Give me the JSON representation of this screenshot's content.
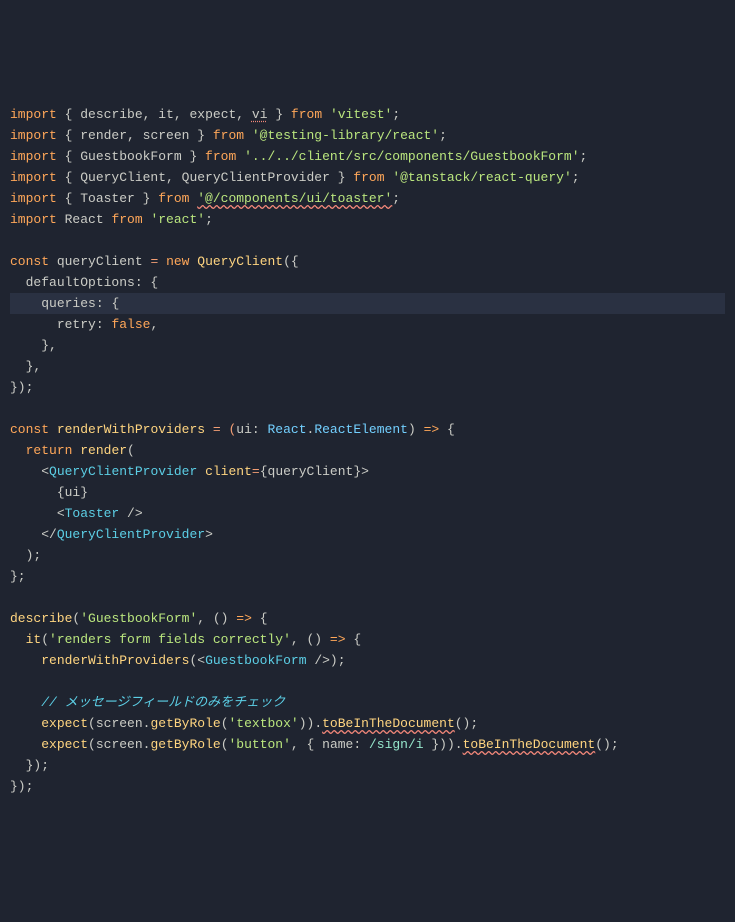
{
  "lines": {
    "l1": {
      "import": "import",
      "lb": "{ ",
      "i1": "describe",
      "c1": ", ",
      "i2": "it",
      "c2": ", ",
      "i3": "expect",
      "c3": ", ",
      "i4": "vi",
      "rb": " }",
      "from": " from ",
      "str": "'vitest'",
      "end": ";"
    },
    "l2": {
      "import": "import",
      "lb": " { ",
      "i1": "render",
      "c1": ", ",
      "i2": "screen",
      "rb": " }",
      "from": " from ",
      "str": "'@testing-library/react'",
      "end": ";"
    },
    "l3": {
      "import": "import",
      "lb": " { ",
      "i1": "GuestbookForm",
      "rb": " }",
      "from": " from ",
      "str": "'../../client/src/components/GuestbookForm'",
      "end": ";"
    },
    "l4": {
      "import": "import",
      "lb": " { ",
      "i1": "QueryClient",
      "c1": ", ",
      "i2": "QueryClientProvider",
      "rb": " }",
      "from": " from ",
      "str": "'@tanstack/react-query'",
      "end": ";"
    },
    "l5": {
      "import": "import",
      "lb": " { ",
      "i1": "Toaster",
      "rb": " }",
      "from": " from ",
      "str": "'@/components/ui/toaster'",
      "end": ";"
    },
    "l6": {
      "import": "import",
      "sp": " ",
      "i1": "React",
      "from": " from ",
      "str": "'react'",
      "end": ";"
    },
    "l8": {
      "const": "const",
      "sp": " ",
      "name": "queryClient",
      "eq": " = ",
      "new": "new",
      "sp2": " ",
      "cls": "QueryClient",
      "paren": "({"
    },
    "l9": {
      "indent": "  ",
      "prop": "defaultOptions",
      "colon": ": {"
    },
    "l10": {
      "indent": "    ",
      "prop": "queries",
      "colon": ": ",
      "brace": "{"
    },
    "l11": {
      "indent": "      ",
      "prop": "retry",
      "colon": ": ",
      "val": "false",
      "end": ","
    },
    "l12": {
      "indent": "    ",
      "brace": "},"
    },
    "l13": {
      "indent": "  ",
      "brace": "},"
    },
    "l14": {
      "brace": "});"
    },
    "l16": {
      "const": "const",
      "sp": " ",
      "name": "renderWithProviders",
      "eq": " = (",
      "param": "ui",
      "colon": ": ",
      "type1": "React",
      "dot": ".",
      "type2": "ReactElement",
      "rparen": ")",
      "arrow": " => ",
      "brace": "{"
    },
    "l17": {
      "indent": "  ",
      "return": "return",
      "sp": " ",
      "fn": "render",
      "paren": "("
    },
    "l18": {
      "indent": "    ",
      "lt": "<",
      "tag": "QueryClientProvider",
      "sp": " ",
      "attr": "client",
      "eq": "=",
      "lb": "{",
      "val": "queryClient",
      "rb": "}",
      "gt": ">"
    },
    "l19": {
      "indent": "      ",
      "lb": "{",
      "val": "ui",
      "rb": "}"
    },
    "l20": {
      "indent": "      ",
      "lt": "<",
      "tag": "Toaster",
      "sp": " ",
      "close": "/>"
    },
    "l21": {
      "indent": "    ",
      "lt": "</",
      "tag": "QueryClientProvider",
      "gt": ">"
    },
    "l22": {
      "indent": "  ",
      "paren": ");"
    },
    "l23": {
      "brace": "};"
    },
    "l25": {
      "fn": "describe",
      "paren": "(",
      "str": "'GuestbookForm'",
      "comma": ", ()",
      "arrow": " => ",
      "brace": "{"
    },
    "l26": {
      "indent": "  ",
      "fn": "it",
      "paren": "(",
      "str": "'renders form fields correctly'",
      "comma": ", ()",
      "arrow": " => ",
      "brace": "{"
    },
    "l27": {
      "indent": "    ",
      "fn": "renderWithProviders",
      "paren": "(",
      "lt": "<",
      "tag": "GuestbookForm",
      "sp": " ",
      "close": "/>",
      "rparen": ");"
    },
    "l29": {
      "indent": "    ",
      "comment": "// メッセージフィールドのみをチェック"
    },
    "l30": {
      "indent": "    ",
      "fn": "expect",
      "paren": "(",
      "obj": "screen",
      "dot": ".",
      "method": "getByRole",
      "paren2": "(",
      "str": "'textbox'",
      "rparen": ")).",
      "method2": "toBeInTheDocument",
      "end": "();"
    },
    "l31": {
      "indent": "    ",
      "fn": "expect",
      "paren": "(",
      "obj": "screen",
      "dot": ".",
      "method": "getByRole",
      "paren2": "(",
      "str": "'button'",
      "comma": ", { ",
      "prop": "name",
      "colon": ": ",
      "regex": "/sign/i",
      "rb": " })).",
      "method2": "toBeInTheDocument",
      "end": "();"
    },
    "l32": {
      "indent": "  ",
      "brace": "});"
    },
    "l33": {
      "brace": "});"
    }
  }
}
